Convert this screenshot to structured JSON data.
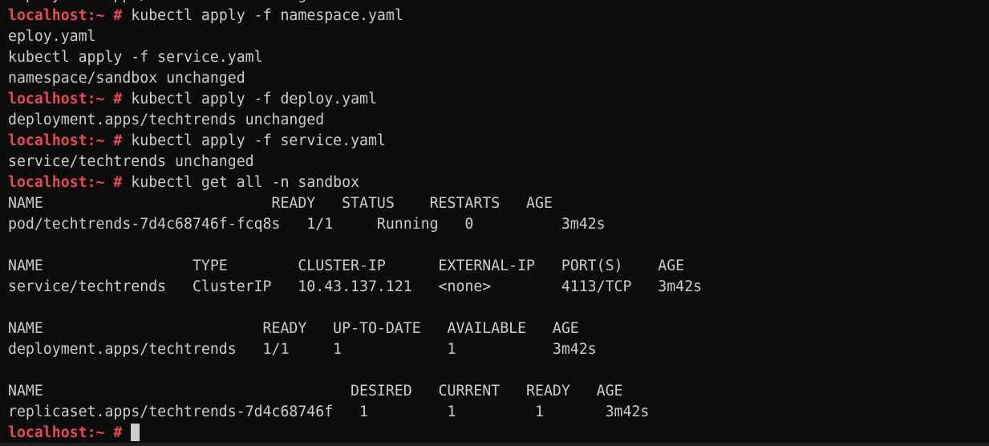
{
  "terminal": {
    "prompt": {
      "host": "localhost",
      "path": ":~",
      "symbol": " # "
    },
    "lines": [
      {
        "type": "output",
        "text": "deployment.apps/techtrends unchanged"
      },
      {
        "type": "prompt",
        "command": "kubectl apply -f namespace.yaml"
      },
      {
        "type": "output",
        "text": "eploy.yaml"
      },
      {
        "type": "output",
        "text": "kubectl apply -f service.yaml"
      },
      {
        "type": "output",
        "text": "namespace/sandbox unchanged"
      },
      {
        "type": "prompt",
        "command": "kubectl apply -f deploy.yaml"
      },
      {
        "type": "output",
        "text": "deployment.apps/techtrends unchanged"
      },
      {
        "type": "prompt",
        "command": "kubectl apply -f service.yaml"
      },
      {
        "type": "output",
        "text": "service/techtrends unchanged"
      },
      {
        "type": "prompt",
        "command": "kubectl get all -n sandbox"
      },
      {
        "type": "output",
        "text": "NAME                          READY   STATUS    RESTARTS   AGE"
      },
      {
        "type": "output",
        "text": "pod/techtrends-7d4c68746f-fcq8s   1/1     Running   0          3m42s"
      },
      {
        "type": "output",
        "text": ""
      },
      {
        "type": "output",
        "text": "NAME                 TYPE        CLUSTER-IP      EXTERNAL-IP   PORT(S)    AGE"
      },
      {
        "type": "output",
        "text": "service/techtrends   ClusterIP   10.43.137.121   <none>        4113/TCP   3m42s"
      },
      {
        "type": "output",
        "text": ""
      },
      {
        "type": "output",
        "text": "NAME                         READY   UP-TO-DATE   AVAILABLE   AGE"
      },
      {
        "type": "output",
        "text": "deployment.apps/techtrends   1/1     1            1           3m42s"
      },
      {
        "type": "output",
        "text": ""
      },
      {
        "type": "output",
        "text": "NAME                                   DESIRED   CURRENT   READY   AGE"
      },
      {
        "type": "output",
        "text": "replicaset.apps/techtrends-7d4c68746f   1         1         1       3m42s"
      },
      {
        "type": "prompt",
        "command": "",
        "cursor": true
      }
    ]
  }
}
